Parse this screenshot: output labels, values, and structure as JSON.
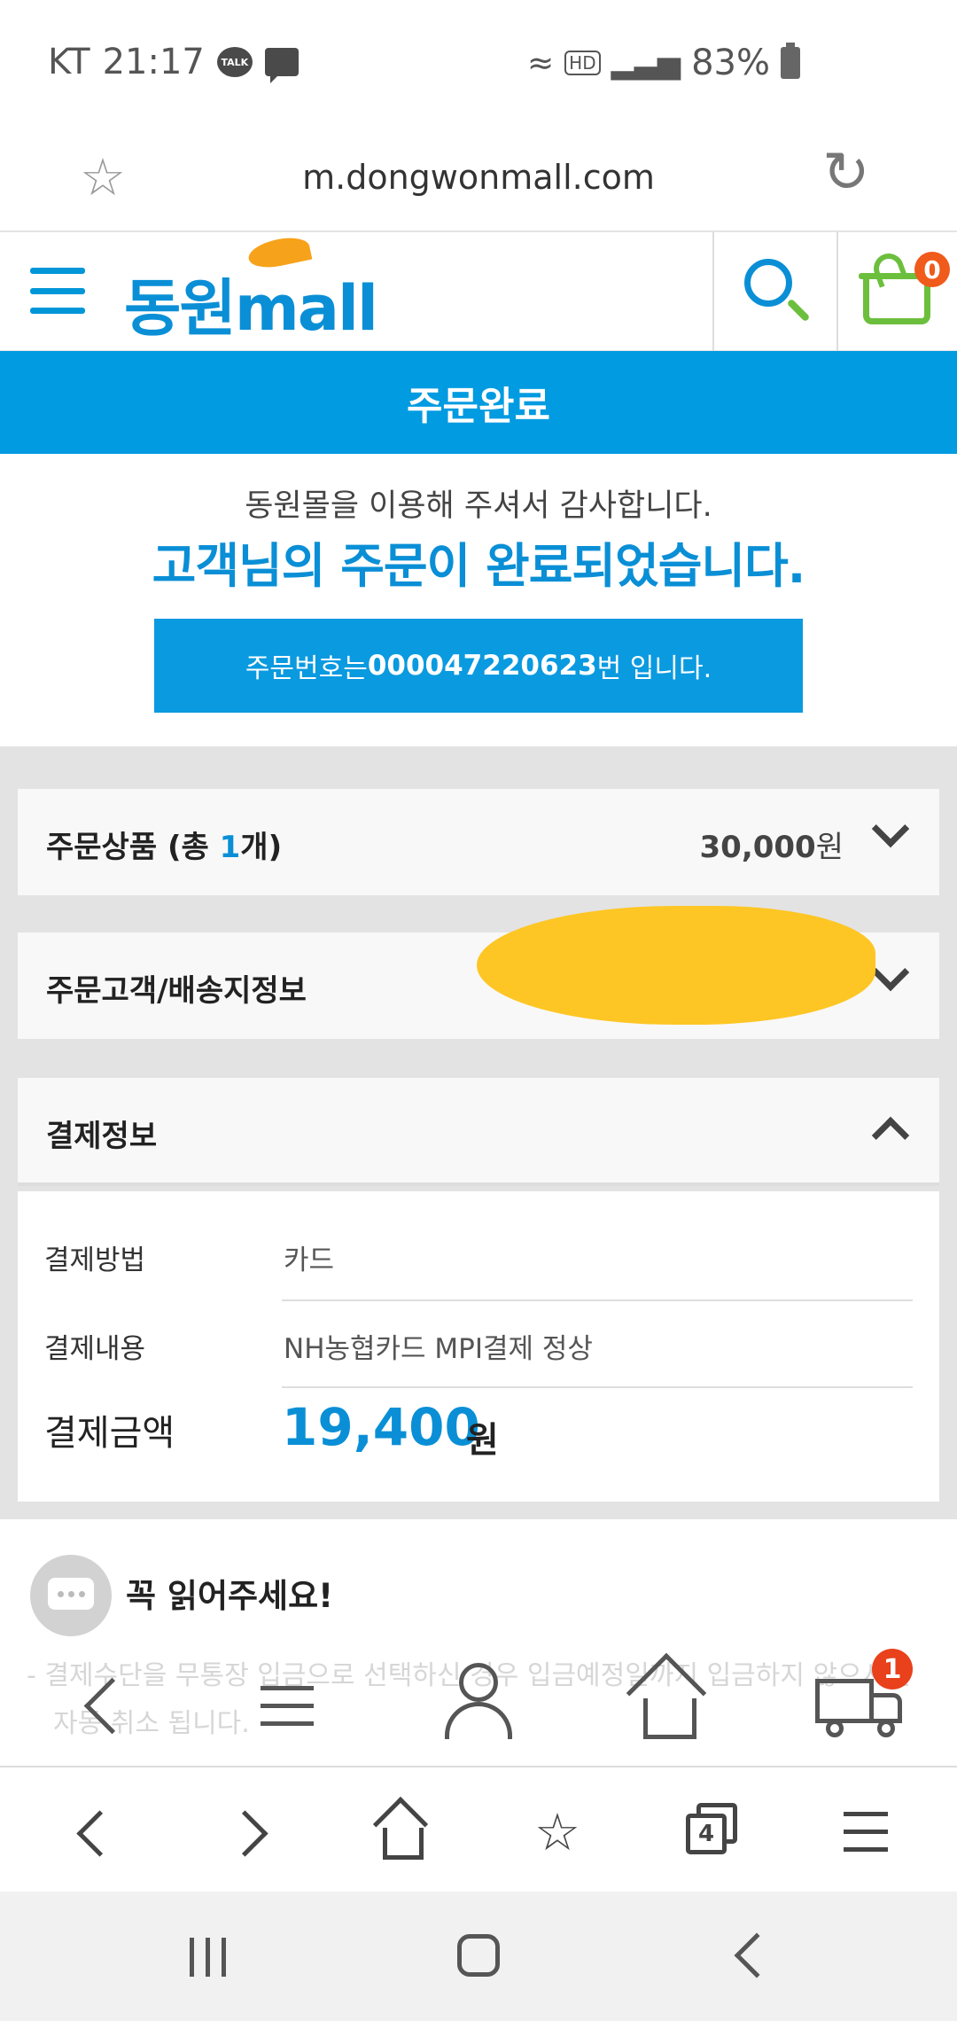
{
  "status_bar": {
    "carrier": "KT",
    "time": "21:17",
    "talk_label": "TALK",
    "network": "HD",
    "battery": "83%"
  },
  "browser": {
    "url": "m.dongwonmall.com"
  },
  "header": {
    "logo_korean": "동원",
    "logo_latin": "mall",
    "cart_count": "0"
  },
  "page": {
    "title": "주문완료",
    "thanks_sub": "동원몰을 이용해 주셔서 감사합니다.",
    "thanks_main": "고객님의 주문이 완료되었습니다.",
    "order_prefix": "주문번호는 ",
    "order_number": "000047220623",
    "order_suffix": "번 입니다."
  },
  "sections": {
    "products": {
      "title_prefix": "주문상품 (총 ",
      "count": "1",
      "title_suffix": "개)",
      "price": "30,000",
      "price_unit": "원"
    },
    "customer": {
      "title": "주문고객/배송지정보"
    },
    "payment": {
      "title": "결제정보",
      "method_label": "결제방법",
      "method_value": "카드",
      "detail_label": "결제내용",
      "detail_value": "NH농협카드 MPI결제 정상",
      "amount_label": "결제금액",
      "amount_value": "19,400",
      "amount_unit": "원"
    }
  },
  "notice": {
    "title": "꼭 읽어주세요!",
    "line1": "- 결제수단을 무통장 입금으로 선택하신 경우 입금예정일까지 입금하지 않으시면",
    "line2": "자동 취소 됩니다."
  },
  "site_nav": {
    "delivery_badge": "1"
  },
  "browser_bar": {
    "tabs_count": "4"
  },
  "colors": {
    "brand_blue": "#009be1",
    "brand_green": "#6cbf3d",
    "brand_orange": "#f7a21b",
    "badge_red": "#e8411c"
  }
}
